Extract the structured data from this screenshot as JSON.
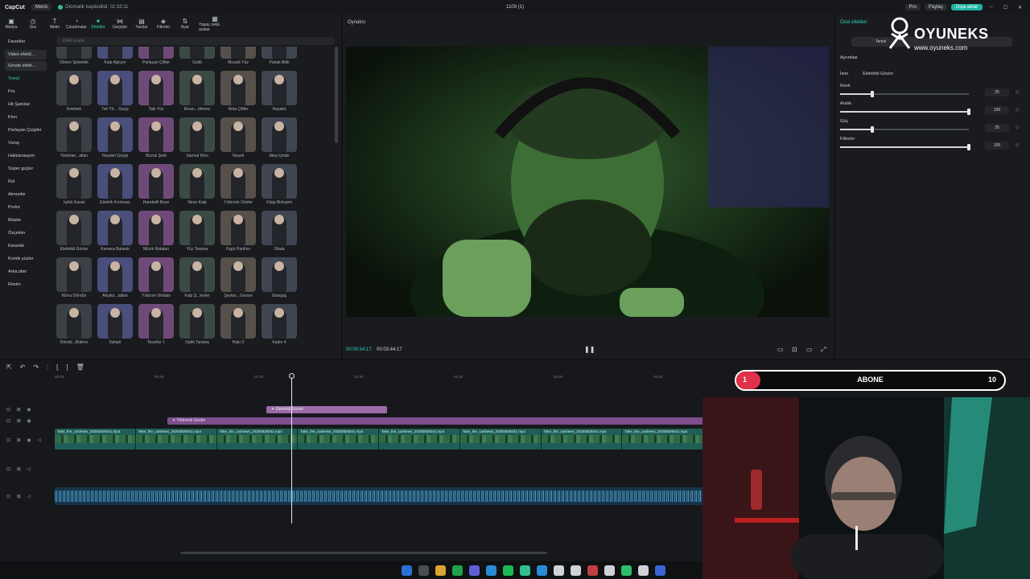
{
  "titlebar": {
    "app_name": "CapCut",
    "menu_label": "Menü",
    "autosave": "Otomatik kaydedildi: 02:33:11",
    "project_title": "1109 (1)",
    "pro_label": "Pro",
    "share_label": "Paylaş",
    "export_label": "Dışa aktar"
  },
  "toolbar": {
    "tools": [
      "Medya",
      "Ses",
      "Metin",
      "Çıkartmalar",
      "Efektler",
      "Geçişler",
      "Yazılar",
      "Filtreler",
      "Ayar",
      "Yapay zekâ avatar"
    ],
    "active_tool": "Efektler"
  },
  "categories": {
    "top": [
      "Favoriler",
      "Video efektl...",
      "Gövde efekt..."
    ],
    "list": [
      "Trend",
      "Pro",
      "Hit Şarkılar",
      "Klon",
      "Parlayan Çizgiler",
      "Vuruş",
      "Halüsinasyon",
      "Süper güçler",
      "Rol",
      "Atmosfer",
      "Portre",
      "Maske",
      "Özçekim",
      "Karanlık",
      "Komik yüzler",
      "Arka plan",
      "Resim"
    ],
    "active": "Trend"
  },
  "search": {
    "placeholder": "Efekt arayın"
  },
  "effects": [
    "Dönen Şekerlek",
    "Kalp Ağrıyor",
    "Parlayan Çiftler",
    "Gotik",
    "Mozaik Yüz",
    "Parlak Bitki",
    "Kelebek",
    "Tek Yö... Geçiş",
    "Tatlı Yüz",
    "Ekran...dönme",
    "Nota Çiftler",
    "Hayalet",
    "Yankılan...altan",
    "Hayalet Geçişi",
    "Bozuk Şerit",
    "Sarmal Klon",
    "Neşeli",
    "Ateş İçinde",
    "Işıltılı Kanat",
    "Elektrik Kırılması",
    "Hareketli Bose",
    "Neon Kalp",
    "Yıldırımlı Gözler",
    "Kitap Birleşimi",
    "Elektrikli Gözler",
    "Kamera Bulanık",
    "Müzik Notaları",
    "Yüz Tarama",
    "Figür Parıltısı",
    "Okala",
    "Klonu Döndür",
    "Akışka...tatlan",
    "Yıldızım Girdabı",
    "Kalp Ş...lenler",
    "Şeytan...Gecesi",
    "Utangaç",
    "Döndü...Bükme",
    "Vampir",
    "Tesahür 1",
    "Optik Tarama",
    "Halo 2",
    "Kadın 4"
  ],
  "player": {
    "title": "Oynatıcı",
    "current_time": "00:00:54:17",
    "total_time": "00:03:44:17"
  },
  "properties": {
    "title": "Özel efektler",
    "tab": "Temel",
    "section": "Ayrıntılar",
    "name_label": "İsim",
    "name_value": "Elektrikli Gözler",
    "params": [
      {
        "label": "Renk",
        "value": "25",
        "level": 0.25
      },
      {
        "label": "Aralık",
        "value": "100",
        "level": 1.0
      },
      {
        "label": "Güç",
        "value": "25",
        "level": 0.25
      },
      {
        "label": "Filtreler",
        "value": "100",
        "level": 1.0
      }
    ]
  },
  "brand": {
    "name": "OYUNEKS",
    "url": "www.oyuneks.com"
  },
  "timeline": {
    "ruler": [
      "00:00",
      "00:40",
      "01:00",
      "01:20",
      "01:40",
      "02:00",
      "02:20",
      "02:40"
    ],
    "effect_clip": "Elektrikli Gözler",
    "filter_clip": "Yıldırımlı Gözler",
    "video_clip_name": "Take_the_cashews_20250926041.mp4",
    "video_segments": 8
  },
  "subscribe": {
    "from": "1",
    "label": "ABONE",
    "to": "10",
    "progress": 0.09
  },
  "colors": {
    "accent": "#2fd2c0",
    "export": "#1fb5a3",
    "effect_clip": "#9b6ba8",
    "video_clip": "#1f5e57",
    "audio_clip": "#153548",
    "subscribe": "#e0304a"
  }
}
